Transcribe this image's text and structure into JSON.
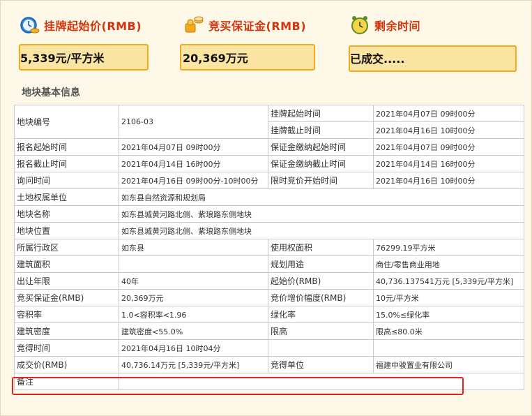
{
  "header": {
    "start_price": {
      "title": "挂牌起始价(RMB)",
      "value": "5,339元/平方米",
      "icon": "clock-money-icon"
    },
    "deposit": {
      "title": "竞买保证金(RMB)",
      "value": "20,369万元",
      "icon": "coin-puzzle-icon"
    },
    "remaining": {
      "title": "剩余时间",
      "value": "已成交.....",
      "icon": "alarm-clock-icon"
    }
  },
  "section": {
    "title": "地块基本信息"
  },
  "table": {
    "rows": [
      {
        "l1": "地块编号",
        "v1": "2106-03",
        "l2": "挂牌起始时间",
        "v2": "2021年04月07日 09时00分"
      },
      {
        "l2": "挂牌截止时间",
        "v2": "2021年04月16日 10时00分"
      },
      {
        "l1": "报名起始时间",
        "v1": "2021年04月07日 09时00分",
        "l2": "保证金缴纳起始时间",
        "v2": "2021年04月07日 09时00分"
      },
      {
        "l1": "报名截止时间",
        "v1": "2021年04月14日 16时00分",
        "l2": "保证金缴纳截止时间",
        "v2": "2021年04月14日 16时00分"
      },
      {
        "l1": "询问时间",
        "v1": "2021年04月16日 09时00分-10时00分",
        "l2": "限时竞价开始时间",
        "v2": "2021年04月16日 10时00分"
      },
      {
        "l1": "土地权属单位",
        "v1": "如东县自然资源和规划局"
      },
      {
        "l1": "地块名称",
        "v1": "如东县城黄河路北侧、紫琅路东侧地块"
      },
      {
        "l1": "地块位置",
        "v1": "如东县城黄河路北侧、紫琅路东侧地块"
      },
      {
        "l1": "所属行政区",
        "v1": "如东县",
        "l2": "使用权面积",
        "v2": "76299.19平方米"
      },
      {
        "l1": "建筑面积",
        "v1": "",
        "l2": "规划用途",
        "v2": "商住/零售商业用地"
      },
      {
        "l1": "出让年限",
        "v1": "40年",
        "l2": "起始价(RMB)",
        "v2": "40,736.137541万元 [5,339元/平方米]"
      },
      {
        "l1": "竞买保证金(RMB)",
        "v1": "20,369万元",
        "l2": "竞价增价幅度(RMB)",
        "v2": "10元/平方米"
      },
      {
        "l1": "容积率",
        "v1": "1.0<容积率<1.96",
        "l2": "绿化率",
        "v2": "15.0%≤绿化率"
      },
      {
        "l1": "建筑密度",
        "v1": "建筑密度<55.0%",
        "l2": "限高",
        "v2": "限高≤80.0米"
      },
      {
        "l1": "竞得时间",
        "v1": "2021年04月16日 10时04分",
        "l2": "",
        "v2": ""
      },
      {
        "l1": "成交价(RMB)",
        "v1": "40,736.14万元 [5,339元/平方米]",
        "l2": "竞得单位",
        "v2": "福建中骏置业有限公司"
      },
      {
        "l1": "备注",
        "v1": ""
      }
    ]
  },
  "colors": {
    "accent": "#d2340e",
    "box_fill": "#fbe5a3",
    "box_border": "#f2a91b",
    "highlight": "#e3241c"
  }
}
